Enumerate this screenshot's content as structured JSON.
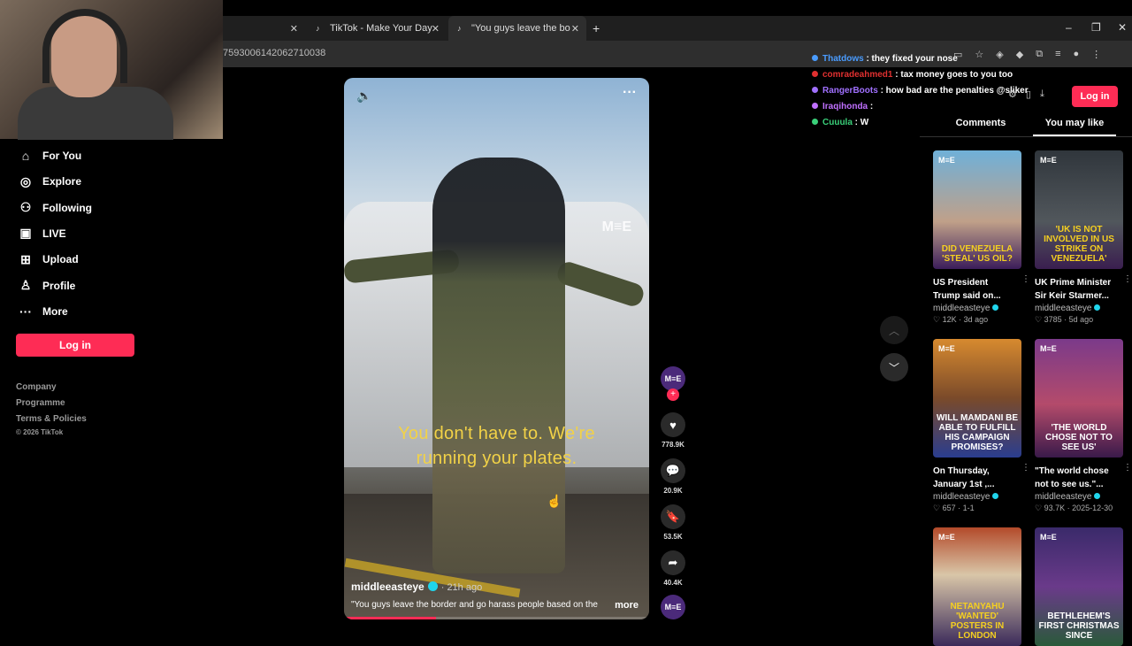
{
  "browser": {
    "tabs": [
      {
        "label": "",
        "icon": "tiktok-icon"
      },
      {
        "label": "TikTok - Make Your Day",
        "icon": "tiktok-icon"
      },
      {
        "label": "\"You guys leave the border and",
        "icon": "tiktok-icon"
      }
    ],
    "new_tab": "+",
    "url": "7593006142062710038",
    "window_controls": {
      "minimize": "–",
      "restore": "❐",
      "close": "✕"
    }
  },
  "chat": [
    {
      "user": "Thatdows",
      "message": ": they fixed your nose",
      "color": "#4a9cff"
    },
    {
      "user": "comradeahmed1",
      "message": ": tax money goes to you too",
      "color": "#e03030"
    },
    {
      "user": "RangerBoots",
      "message": ": how bad are the penalties @sliker",
      "color": "#a070ff"
    },
    {
      "user": "Iraqihonda",
      "message": ":",
      "color": "#c070ff"
    },
    {
      "user": "Cuuula",
      "message": ": W",
      "color": "#3ad07a"
    }
  ],
  "sidebar": {
    "items": [
      {
        "label": "For You",
        "icon": "home-icon"
      },
      {
        "label": "Explore",
        "icon": "compass-icon"
      },
      {
        "label": "Following",
        "icon": "following-icon"
      },
      {
        "label": "LIVE",
        "icon": "live-icon"
      },
      {
        "label": "Upload",
        "icon": "upload-icon"
      },
      {
        "label": "Profile",
        "icon": "profile-icon"
      },
      {
        "label": "More",
        "icon": "more-icon"
      }
    ],
    "login": "Log in",
    "footer": [
      "Company",
      "Programme",
      "Terms & Policies",
      "© 2026 TikTok"
    ]
  },
  "video": {
    "caption_line1": "You don't have to. We're",
    "caption_line2": "running your plates.",
    "watermark": "M≡E",
    "author": "middleeasteye",
    "time": "· 21h ago",
    "description": "\"You guys leave the border and go harass people based on the",
    "more": "more",
    "progress": 0.3
  },
  "actions": {
    "avatar": "M≡E",
    "likes": "778.9K",
    "comments": "20.9K",
    "saves": "53.5K",
    "shares": "40.4K"
  },
  "right": {
    "login": "Log in",
    "tabs": [
      "Comments",
      "You may like"
    ],
    "cards": [
      {
        "title": "US President Trump said on...",
        "author": "middleeasteye",
        "meta": "♡ 12K · 3d ago",
        "headline": "DID VENEZUELA 'STEAL' US OIL?",
        "headline_color": "#f5d020"
      },
      {
        "title": "UK Prime Minister Sir Keir Starmer...",
        "author": "middleeasteye",
        "meta": "♡ 3785 · 5d ago",
        "headline": "'UK IS NOT INVOLVED IN US STRIKE ON VENEZUELA'",
        "headline_color": "#f5d020"
      },
      {
        "title": "On Thursday, January 1st ,...",
        "author": "middleeasteye",
        "meta": "♡ 657 · 1-1",
        "headline": "WILL MAMDANI BE ABLE TO FULFILL HIS CAMPAIGN PROMISES?",
        "headline_color": "#ffffff"
      },
      {
        "title": "\"The world chose not to see us.\"...",
        "author": "middleeasteye",
        "meta": "♡ 93.7K · 2025-12-30",
        "headline": "'THE WORLD CHOSE NOT TO SEE US'",
        "headline_color": "#ffffff"
      },
      {
        "title": "",
        "author": "",
        "meta": "",
        "headline": "NETANYAHU 'WANTED' POSTERS IN LONDON",
        "headline_color": "#f5d020"
      },
      {
        "title": "",
        "author": "",
        "meta": "",
        "headline": "BETHLEHEM'S FIRST CHRISTMAS SINCE",
        "headline_color": "#ffffff"
      }
    ],
    "mee": "M≡E"
  }
}
